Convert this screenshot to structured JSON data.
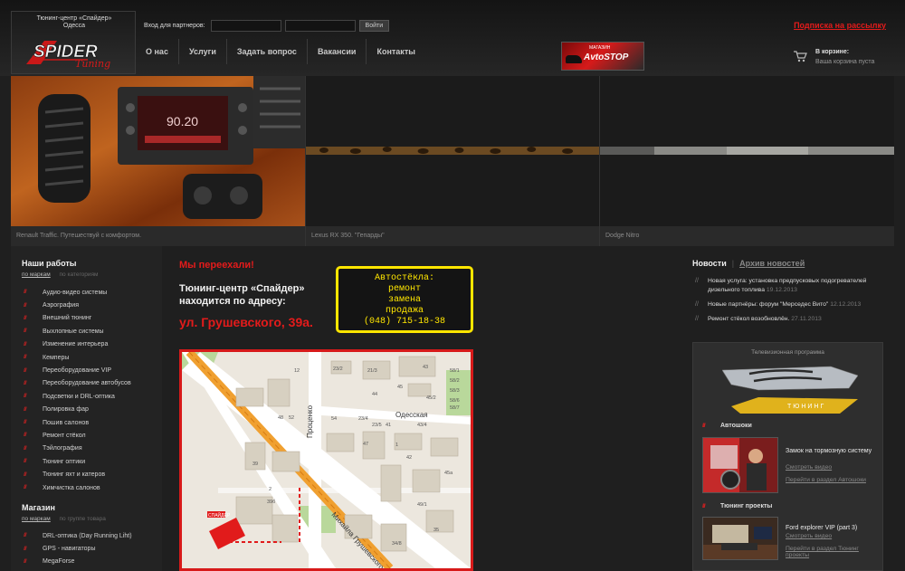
{
  "header": {
    "logo_caption_line1": "Тюнинг-центр «Спайдер»",
    "logo_caption_line2": "Одесса",
    "logo_text": "SPIDER",
    "logo_script": "Tuning",
    "partners_label": "Вход для партнеров:",
    "login_placeholder": "",
    "password_placeholder": "",
    "login_button": "Войти",
    "subscribe": "Подписка на рассылку",
    "nav": [
      "О нас",
      "Услуги",
      "Задать вопрос",
      "Вакансии",
      "Контакты"
    ],
    "banner_sub": "МАГАЗИН",
    "banner_title": "AvtoSTOP",
    "cart_title": "В корзине:",
    "cart_empty": "Ваша корзина пуста"
  },
  "slides": [
    {
      "caption": "Renault Traffic. Путешествуй с комфортом."
    },
    {
      "caption": "Lexus RX 350. \"Гепарды\""
    },
    {
      "caption": "Dodge Nitro"
    }
  ],
  "works": {
    "title": "Наши работы",
    "tab_active": "по маркам",
    "tab_inactive": "по категориям",
    "items": [
      "Аудио-видео системы",
      "Аэрография",
      "Внешний тюнинг",
      "Выхлопные системы",
      "Изменение интерьера",
      "Кемперы",
      "Переоборудование VIP",
      "Переоборудование автобусов",
      "Подсветки и DRL-оптика",
      "Полировка фар",
      "Пошив салонов",
      "Ремонт стёкол",
      "Тэйлография",
      "Тюнинг оптики",
      "Тюнинг яхт и катеров",
      "Химчистка салонов"
    ]
  },
  "shop": {
    "title": "Магазин",
    "tab_active": "по маркам",
    "tab_inactive": "по группе товара",
    "items": [
      "DRL-оптика (Day Running Liht)",
      "GPS - навигаторы",
      "MegaForse"
    ]
  },
  "center": {
    "moved": "Мы переехали!",
    "address_intro": "Тюнинг-центр «Спайдер» находится по адресу:",
    "address": "ул. Грушевского, 39а.",
    "glass_lines": [
      "Автостёкла:",
      "ремонт",
      "замена",
      "продажа",
      "(048) 715-18-38"
    ]
  },
  "map": {
    "labels": [
      "12",
      "23/2",
      "21/3",
      "58/1",
      "58/2",
      "58/3",
      "58/6",
      "58/7",
      "45/2",
      "43",
      "44",
      "45",
      "48",
      "52",
      "54",
      "23/4",
      "23/5",
      "41",
      "42",
      "43/4",
      "45а",
      "49/1",
      "47",
      "1",
      "2",
      "39б",
      "39",
      "34/8",
      "35"
    ],
    "street_odesskaya": "Одесская",
    "street_protsenko": "Проценко",
    "street_grushevskogo": "Михайла Грушевского",
    "marker_label": "СПАЙДЕР"
  },
  "news": {
    "tab_active": "Новости",
    "tab_inactive": "Архив новостей",
    "items": [
      {
        "text": "Новая услуга: установка предпусковых подогревателей дизельного топлива",
        "date": "19.12.2013"
      },
      {
        "text": "Новые партнёры: форум \"Мерседес Вито\"",
        "date": "12.12.2013"
      },
      {
        "text": "Ремонт стёкол возобновлён.",
        "date": "27.11.2013"
      }
    ]
  },
  "tv": {
    "label": "Телевизионная программа",
    "logo_text": "ТЮНИНГ",
    "avto_title": "Автошоки",
    "avto_item_title": "Замок на тормозную систему",
    "avto_watch": "Смотреть видео",
    "avto_section_link": "Перейти в раздел Автошоки",
    "projects_title": "Тюнинг проекты",
    "proj_item_title": "Ford explorer VIP (part 3)",
    "proj_watch": "Смотреть видео",
    "proj_section_link": "Перейти в раздел Тюнинг проекты"
  },
  "colors": {
    "accent_red": "#e31b1b",
    "glass_yellow": "#ffe600",
    "background": "#1f1f1f"
  }
}
